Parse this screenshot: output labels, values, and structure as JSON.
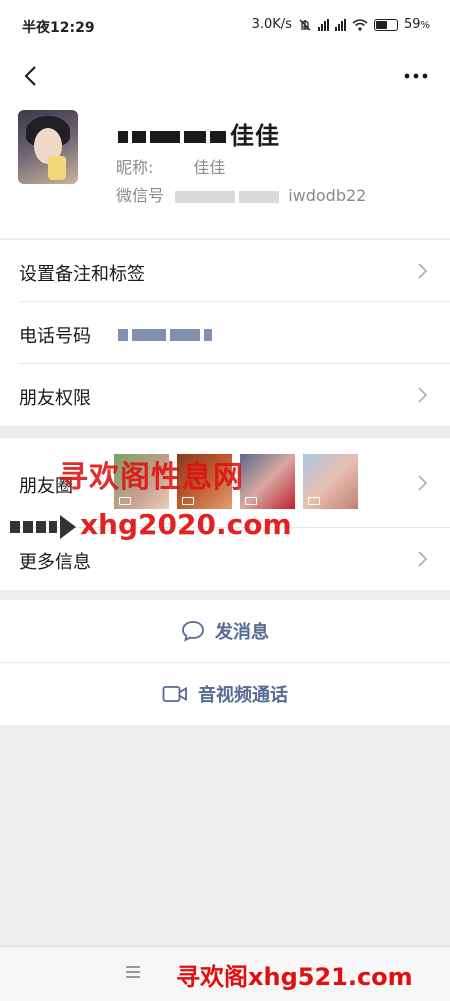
{
  "status_bar": {
    "time": "半夜12:29",
    "speed": "3.0K/s",
    "network1": "HD",
    "network2": "HD",
    "battery": "59",
    "battery_level": 0.59
  },
  "profile": {
    "remark_visible": "佳佳",
    "nickname_label": "昵称:",
    "nickname_value": "佳佳",
    "wechat_id_label": "微信号",
    "wechat_id_visible": "iwdodb22"
  },
  "cells": {
    "set_remark": "设置备注和标签",
    "phone_label": "电话号码",
    "permissions": "朋友权限",
    "moments": "朋友圈",
    "more_info": "更多信息"
  },
  "actions": {
    "send_message": "发消息",
    "video_call": "音视频通话"
  },
  "watermarks": {
    "line1": "寻欢阁性息网",
    "line2": "xhg2020.com",
    "line3": "寻欢阁xhg521.com"
  },
  "colors": {
    "link_blue": "#576b95",
    "background": "#ededed",
    "watermark_red": "#e01010"
  },
  "icons": {
    "back": "chevron-left-icon",
    "more": "ellipsis-icon",
    "chat": "chat-bubble-icon",
    "video": "video-camera-icon"
  }
}
